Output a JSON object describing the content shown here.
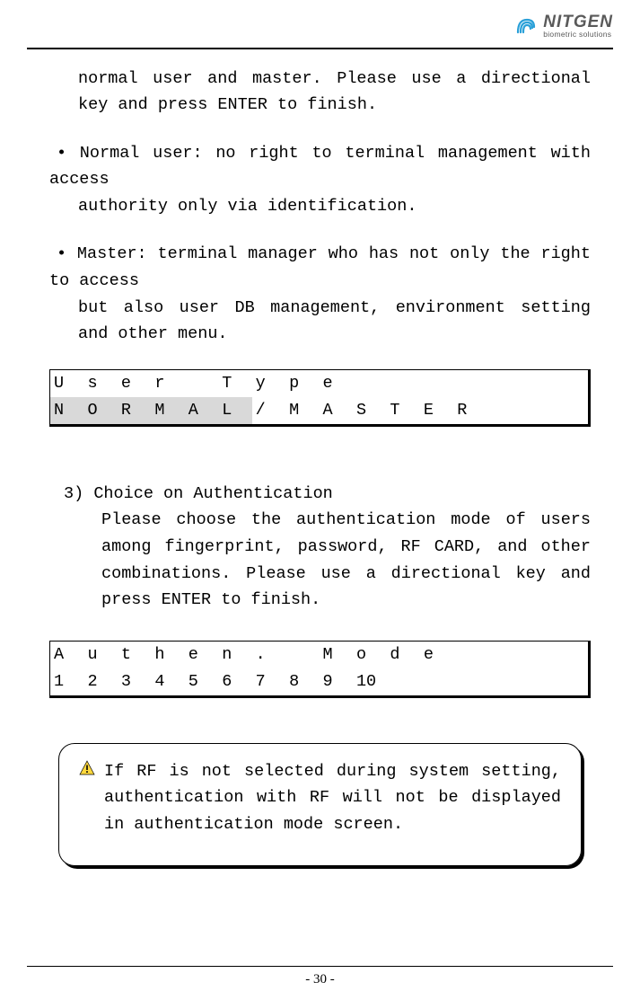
{
  "brand": {
    "name": "NITGEN",
    "sub": "biometric solutions"
  },
  "para1": "normal user and master. Please use a directional key and press ENTER to finish.",
  "bullet_normal_lead": "• Normal user: no right to terminal management with access",
  "bullet_normal_cont": "authority only via identification.",
  "bullet_master_lead": "• Master: terminal manager who has not only the right to access",
  "bullet_master_cont": "but also user DB management, environment setting and other menu.",
  "lcd1": {
    "row1": [
      "U",
      "s",
      "e",
      "r",
      "",
      "T",
      "y",
      "p",
      "e",
      "",
      "",
      "",
      "",
      "",
      "",
      ""
    ],
    "row2": [
      "N",
      "O",
      "R",
      "M",
      "A",
      "L",
      "/",
      "M",
      "A",
      "S",
      "T",
      "E",
      "R",
      "",
      "",
      ""
    ],
    "shade2": [
      true,
      true,
      true,
      true,
      true,
      true,
      false,
      false,
      false,
      false,
      false,
      false,
      false,
      false,
      false,
      false
    ]
  },
  "section_num": "3)",
  "section_title": "Choice on Authentication",
  "section_body": "Please choose the authentication mode of users among fingerprint, password, RF CARD, and other combinations. Please use a directional key and press ENTER to finish.",
  "lcd2": {
    "row1": [
      "A",
      "u",
      "t",
      "h",
      "e",
      "n",
      ".",
      "",
      "M",
      "o",
      "d",
      "e",
      "",
      "",
      "",
      ""
    ],
    "row2": [
      "1",
      "2",
      "3",
      "4",
      "5",
      "6",
      "7",
      "8",
      "9",
      "10",
      "",
      "",
      "",
      "",
      "",
      ""
    ]
  },
  "note": "If RF is not selected during system setting, authentication with RF will not be displayed in authentication mode screen.",
  "page": "- 30 -"
}
